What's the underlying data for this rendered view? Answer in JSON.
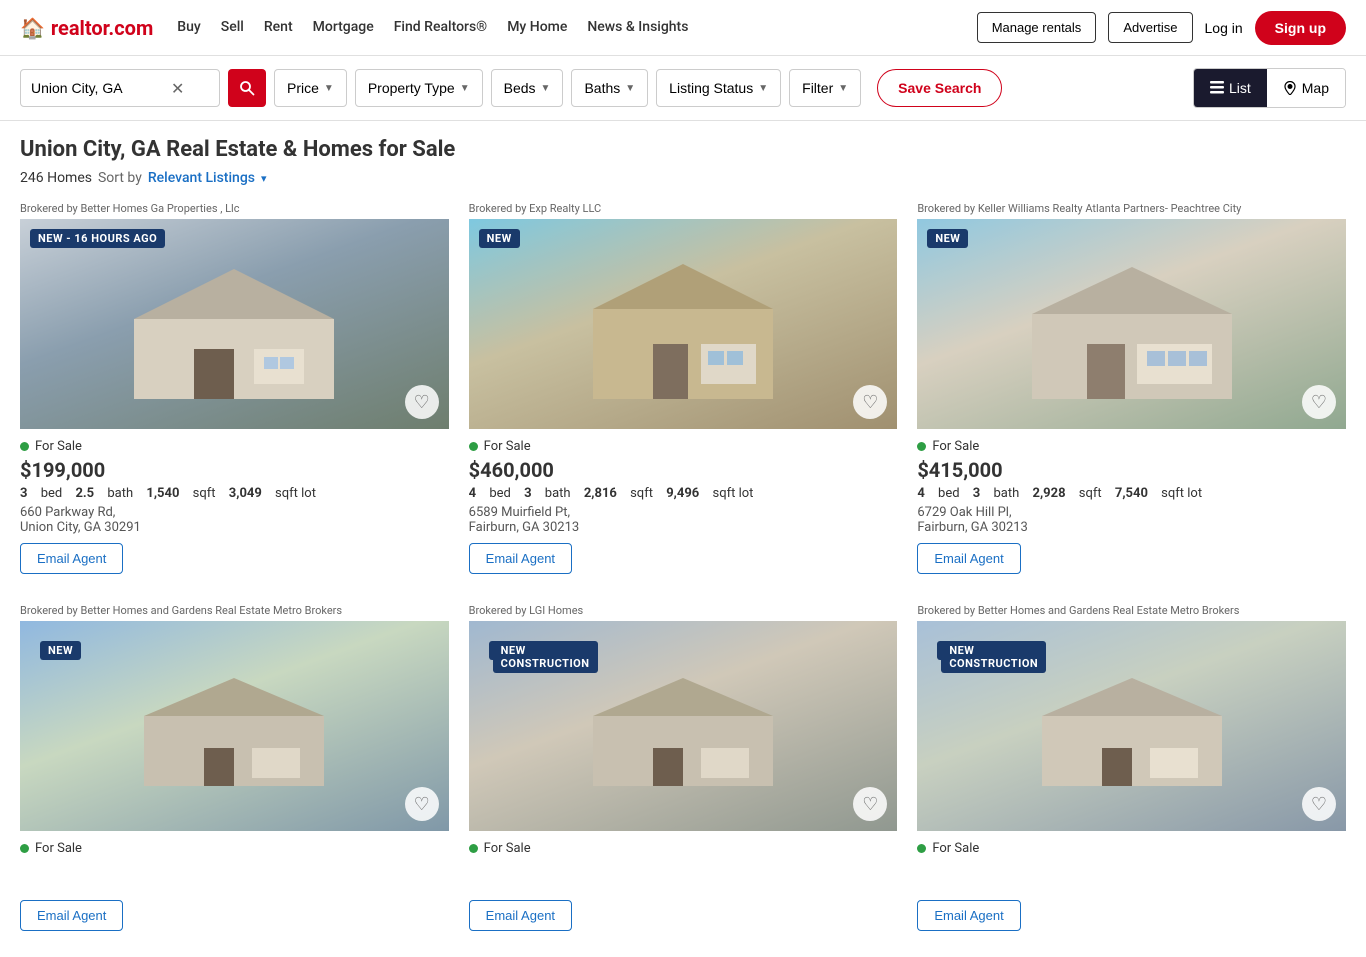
{
  "logo": {
    "house": "🏠",
    "text": "realtor.com"
  },
  "nav": {
    "links": [
      {
        "label": "Buy",
        "id": "buy"
      },
      {
        "label": "Sell",
        "id": "sell"
      },
      {
        "label": "Rent",
        "id": "rent"
      },
      {
        "label": "Mortgage",
        "id": "mortgage"
      },
      {
        "label": "Find Realtors®",
        "id": "find-realtors"
      },
      {
        "label": "My Home",
        "id": "my-home"
      },
      {
        "label": "News & Insights",
        "id": "news-insights"
      }
    ],
    "manage_rentals": "Manage rentals",
    "advertise": "Advertise",
    "login": "Log in",
    "signup": "Sign up"
  },
  "search": {
    "location_value": "Union City, GA",
    "price_label": "Price",
    "property_type_label": "Property Type",
    "beds_label": "Beds",
    "baths_label": "Baths",
    "listing_status_label": "Listing Status",
    "filter_label": "Filter",
    "save_search_label": "Save Search"
  },
  "view_toggle": {
    "list_label": "List",
    "map_label": "Map"
  },
  "results": {
    "title": "Union City, GA Real Estate & Homes for Sale",
    "count": "246 Homes",
    "sort_prefix": "Sort by",
    "sort_label": "Relevant Listings"
  },
  "listings": [
    {
      "broker": "Brokered by Better Homes Ga Properties , Llc",
      "badge": "NEW - 16 HOURS AGO",
      "badge2": "",
      "status": "For Sale",
      "price": "$199,000",
      "beds": "3",
      "baths": "2.5",
      "sqft": "1,540",
      "lot_sqft": "3,049",
      "address_line1": "660 Parkway Rd,",
      "address_line2": "Union City, GA 30291",
      "email_btn": "Email Agent",
      "img_class": "img-placeholder-1"
    },
    {
      "broker": "Brokered by Exp Realty LLC",
      "badge": "NEW",
      "badge2": "",
      "status": "For Sale",
      "price": "$460,000",
      "beds": "4",
      "baths": "3",
      "sqft": "2,816",
      "lot_sqft": "9,496",
      "address_line1": "6589 Muirfield Pt,",
      "address_line2": "Fairburn, GA 30213",
      "email_btn": "Email Agent",
      "img_class": "img-placeholder-2"
    },
    {
      "broker": "Brokered by Keller Williams Realty Atlanta Partners- Peachtree City",
      "badge": "NEW",
      "badge2": "",
      "status": "For Sale",
      "price": "$415,000",
      "beds": "4",
      "baths": "3",
      "sqft": "2,928",
      "lot_sqft": "7,540",
      "address_line1": "6729 Oak Hill Pl,",
      "address_line2": "Fairburn, GA 30213",
      "email_btn": "Email Agent",
      "img_class": "img-placeholder-3"
    },
    {
      "broker": "Brokered by Better Homes and Gardens Real Estate Metro Brokers",
      "badge": "NEW",
      "badge2": "",
      "status": "For Sale",
      "price": "",
      "beds": "",
      "baths": "",
      "sqft": "",
      "lot_sqft": "",
      "address_line1": "",
      "address_line2": "",
      "email_btn": "Email Agent",
      "img_class": "img-placeholder-4"
    },
    {
      "broker": "Brokered by LGI Homes",
      "badge": "NEW",
      "badge2": "NEW CONSTRUCTION",
      "status": "For Sale",
      "price": "",
      "beds": "",
      "baths": "",
      "sqft": "",
      "lot_sqft": "",
      "address_line1": "",
      "address_line2": "",
      "email_btn": "Email Agent",
      "img_class": "img-placeholder-5"
    },
    {
      "broker": "Brokered by Better Homes and Gardens Real Estate Metro Brokers",
      "badge": "NEW",
      "badge2": "NEW CONSTRUCTION",
      "status": "For Sale",
      "price": "",
      "beds": "",
      "baths": "",
      "sqft": "",
      "lot_sqft": "",
      "address_line1": "",
      "address_line2": "",
      "email_btn": "Email Agent",
      "img_class": "img-placeholder-6"
    }
  ]
}
